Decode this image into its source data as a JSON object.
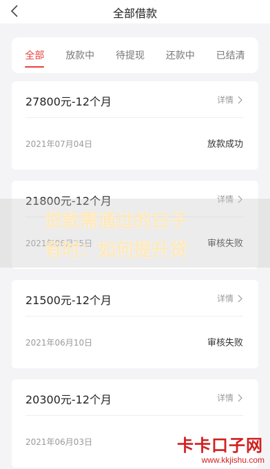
{
  "header": {
    "title": "全部借款",
    "back_icon": "chevron-left-icon"
  },
  "tabs": [
    {
      "label": "全部",
      "active": true
    },
    {
      "label": "放款中",
      "active": false
    },
    {
      "label": "待提现",
      "active": false
    },
    {
      "label": "还款中",
      "active": false
    },
    {
      "label": "已结清",
      "active": false
    }
  ],
  "loans": [
    {
      "amount": "27800元-12个月",
      "detail": "详情",
      "date": "2021年07月04日",
      "status": "放款成功"
    },
    {
      "amount": "21800元-12个月",
      "detail": "详情",
      "date": "2021年06月25日",
      "status": "审核失败"
    },
    {
      "amount": "21500元-12个月",
      "detail": "详情",
      "date": "2021年06月10日",
      "status": "审核失败"
    },
    {
      "amount": "20300元-12个月",
      "detail": "详情",
      "date": "2021年06月03日",
      "status": ""
    }
  ],
  "overlay": {
    "line1": "贷款需通过的日子",
    "line2": "有时：如何提升贷"
  },
  "watermark": {
    "title": "卡卡口子网",
    "url": "www.kkjishu.com"
  },
  "colors": {
    "accent": "#e8403c",
    "background": "#f4f4f6",
    "watermark": "#d0201f"
  }
}
